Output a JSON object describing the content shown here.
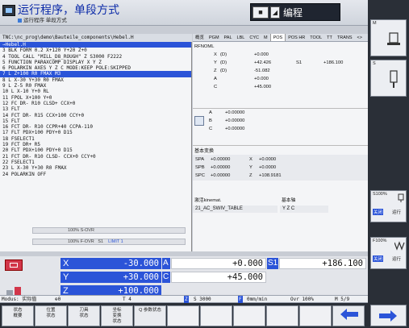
{
  "header": {
    "title": "运行程序，单段方式",
    "subtitle": "运行程序 单段方式",
    "mode": "编程",
    "btn_square": "■",
    "btn_cursor": "◢"
  },
  "program": {
    "path": "TNC:\\nc_prog\\demo\\Bauteile_components\\Hebel.H",
    "header_line": "→Hebel.H",
    "lines": [
      "3  BLK FORM 0.2  X+120  Y+20  Z+0",
      "4  TOOL CALL \"MILL_D8_ROUGH\" Z S3000 F2222",
      "5  FUNCTION PARAXCOMP DISPLAY X Y Z",
      "6  POLARKIN AXES Y Z C MODE:KEEP POLE:SKIPPED",
      "7  L  Z+100 R0 FMAX M3",
      "8  L  X-30  Y+30 R0 FMAX",
      "9  L  Z-5 R0 FMAX",
      "10 L  X-10  Y+0 RL",
      "11 FPOL  X+100  Y+0",
      "12 FC DR- R10 CLSD+  CCX+0",
      "13 FLT",
      "14 FCT DR- R15  CCX+100  CCY+0",
      "15 FLT",
      "16 FCT DR- R10  CCPR+40  CCPA-110",
      "17 FLT PDX+100 PDY+0 D15",
      "18 FSELECT1",
      "19 FCT DR+ R5",
      "20 FLT PDX+100 PDY+0 D15",
      "21 FCT DR- R10 CLSD-  CCX+0  CCY+0",
      "22 FSELECT1",
      "23 L  X-30  Y+30 R0 FMAX",
      "24 POLARKIN OFF"
    ],
    "selected_index": 4
  },
  "overrides": {
    "spindle": "100% S-OVR",
    "feed": "100% F-OVR",
    "feed_extra": "S1",
    "limit": "LIMIT 1"
  },
  "status": {
    "tabs": [
      "概览",
      "PGM",
      "PAL",
      "LBL",
      "CYC",
      "M",
      "POS",
      "POS HR",
      "TOOL",
      "TT",
      "TRANS",
      "<>"
    ],
    "active_tab": "POS",
    "pos_label": "RFNOML",
    "positions": [
      {
        "axis": "X",
        "kind": "(D)",
        "value": "+0.000",
        "s_label": "",
        "s_value": ""
      },
      {
        "axis": "Y",
        "kind": "(D)",
        "value": "+42.426",
        "s_label": "S1",
        "s_value": "+186.100"
      },
      {
        "axis": "Z",
        "kind": "(D)",
        "value": "-51.082",
        "s_label": "",
        "s_value": ""
      },
      {
        "axis": "A",
        "kind": "",
        "value": "+0.000",
        "s_label": "",
        "s_value": ""
      },
      {
        "axis": "C",
        "kind": "",
        "value": "+45.000",
        "s_label": "",
        "s_value": ""
      }
    ],
    "rot_axes": [
      {
        "axis": "A",
        "value": "+0.00000"
      },
      {
        "axis": "B",
        "value": "+0.00000"
      },
      {
        "axis": "C",
        "value": "+0.00000"
      }
    ],
    "transform_title": "基本变换",
    "transforms": [
      {
        "label": "SPA",
        "v1": "+0.00000",
        "axis": "X",
        "v2": "+0.0000"
      },
      {
        "label": "SPB",
        "v1": "+0.00000",
        "axis": "Y",
        "v2": "+0.0000"
      },
      {
        "label": "SPC",
        "v1": "+0.00000",
        "axis": "Z",
        "v2": "+108.9181"
      }
    ],
    "kin_title": "激活kinemat.",
    "kin_value": "21_AC_SWIV_TABLE",
    "base_axes_title": "基本轴",
    "base_axes_value": "Y Z C"
  },
  "axes": {
    "rows": [
      {
        "a1": "X",
        "v1": "-30.000",
        "a2": "A",
        "v2": "+0.000",
        "a3": "S1",
        "v3": "+186.100"
      },
      {
        "a1": "Y",
        "v1": "+30.000",
        "a2": "C",
        "v2": "+45.000",
        "a3": "",
        "v3": ""
      },
      {
        "a1": "Z",
        "v1": "+100.000",
        "a2": "",
        "v2": "",
        "a3": "",
        "v3": ""
      }
    ]
  },
  "strip": {
    "modus": "Modus: 实际值",
    "pos": "⊕0",
    "tool": "T 4",
    "z": "Z",
    "spindle": "S 3000",
    "feed": "0mm/min",
    "ovr": "Ovr 100%",
    "m": "M 5/9"
  },
  "softkeys": [
    {
      "line1": "状态",
      "line2": "概要"
    },
    {
      "line1": "位置",
      "line2": "状态"
    },
    {
      "line1": "刀具",
      "line2": "状态"
    },
    {
      "line1": "坐标",
      "line2": "变换",
      "line3": "状态"
    },
    {
      "line1": "Q 参数状态",
      "line2": ""
    },
    {
      "line1": "",
      "line2": ""
    },
    {
      "line1": "",
      "line2": ""
    },
    {
      "line1": "",
      "line2": ""
    },
    {
      "line1": "",
      "line2": ""
    },
    {
      "line1": "",
      "line2": ""
    },
    {
      "line1": "",
      "line2": ""
    }
  ],
  "sidebar": {
    "m_label": "M",
    "s_label": "S",
    "s_ovr": "S100%",
    "s_run": "运行",
    "f_ovr": "F100%",
    "f_run": "运行",
    "off1": "关闭",
    "off2": "关闭"
  }
}
